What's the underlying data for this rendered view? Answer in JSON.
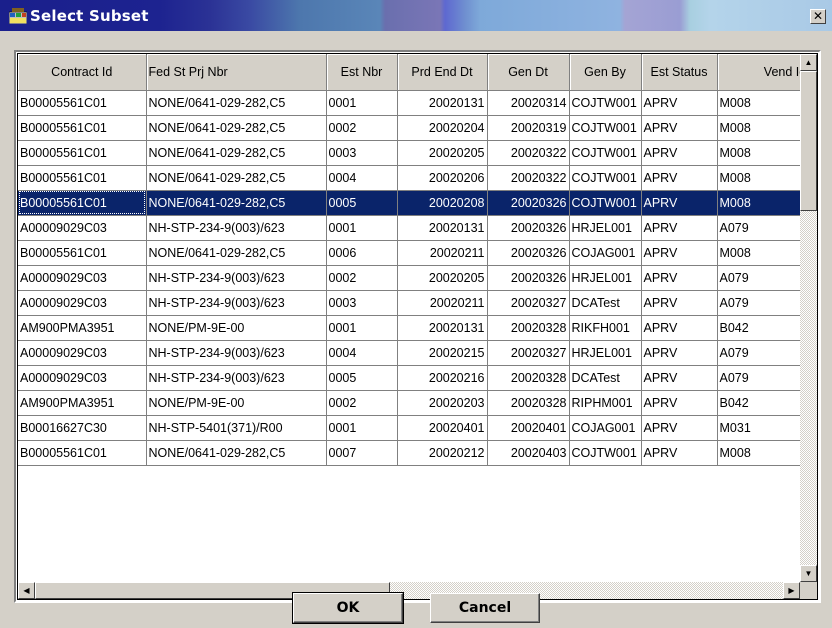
{
  "window": {
    "title": "Select Subset",
    "close_label": "✕"
  },
  "grid": {
    "columns": [
      "Contract Id",
      "Fed St Prj Nbr",
      "Est Nbr",
      "Prd End Dt",
      "Gen Dt",
      "Gen By",
      "Est Status",
      "Vend Id"
    ],
    "column_header_visible": [
      "Contract Id",
      "Fed St Prj Nbr",
      "Est Nbr",
      "Prd End Dt",
      "Gen Dt",
      "Gen By",
      "Est Status",
      "Vend Ic"
    ],
    "selected_row_index": 4,
    "rows": [
      [
        "B00005561C01",
        "NONE/0641-029-282,C5",
        "0001",
        "20020131",
        "20020314",
        "COJTW001",
        "APRV",
        "M008"
      ],
      [
        "B00005561C01",
        "NONE/0641-029-282,C5",
        "0002",
        "20020204",
        "20020319",
        "COJTW001",
        "APRV",
        "M008"
      ],
      [
        "B00005561C01",
        "NONE/0641-029-282,C5",
        "0003",
        "20020205",
        "20020322",
        "COJTW001",
        "APRV",
        "M008"
      ],
      [
        "B00005561C01",
        "NONE/0641-029-282,C5",
        "0004",
        "20020206",
        "20020322",
        "COJTW001",
        "APRV",
        "M008"
      ],
      [
        "B00005561C01",
        "NONE/0641-029-282,C5",
        "0005",
        "20020208",
        "20020326",
        "COJTW001",
        "APRV",
        "M008"
      ],
      [
        "A00009029C03",
        "NH-STP-234-9(003)/623",
        "0001",
        "20020131",
        "20020326",
        "HRJEL001",
        "APRV",
        "A079"
      ],
      [
        "B00005561C01",
        "NONE/0641-029-282,C5",
        "0006",
        "20020211",
        "20020326",
        "COJAG001",
        "APRV",
        "M008"
      ],
      [
        "A00009029C03",
        "NH-STP-234-9(003)/623",
        "0002",
        "20020205",
        "20020326",
        "HRJEL001",
        "APRV",
        "A079"
      ],
      [
        "A00009029C03",
        "NH-STP-234-9(003)/623",
        "0003",
        "20020211",
        "20020327",
        "DCATest",
        "APRV",
        "A079"
      ],
      [
        "AM900PMA3951",
        "NONE/PM-9E-00",
        "0001",
        "20020131",
        "20020328",
        "RIKFH001",
        "APRV",
        "B042"
      ],
      [
        "A00009029C03",
        "NH-STP-234-9(003)/623",
        "0004",
        "20020215",
        "20020327",
        "HRJEL001",
        "APRV",
        "A079"
      ],
      [
        "A00009029C03",
        "NH-STP-234-9(003)/623",
        "0005",
        "20020216",
        "20020328",
        "DCATest",
        "APRV",
        "A079"
      ],
      [
        "AM900PMA3951",
        "NONE/PM-9E-00",
        "0002",
        "20020203",
        "20020328",
        "RIPHM001",
        "APRV",
        "B042"
      ],
      [
        "B00016627C30",
        "NH-STP-5401(371)/R00",
        "0001",
        "20020401",
        "20020401",
        "COJAG001",
        "APRV",
        "M031"
      ],
      [
        "B00005561C01",
        "NONE/0641-029-282,C5",
        "0007",
        "20020212",
        "20020403",
        "COJTW001",
        "APRV",
        "M008"
      ]
    ]
  },
  "buttons": {
    "ok_label": "OK",
    "cancel_label": "Cancel"
  },
  "icons": {
    "app": "dialog-app-icon",
    "close": "close-icon",
    "scroll_up": "scroll-up-arrow-icon",
    "scroll_down": "scroll-down-arrow-icon",
    "scroll_left": "scroll-left-arrow-icon",
    "scroll_right": "scroll-right-arrow-icon"
  },
  "colors": {
    "selection": "#0a246a",
    "face": "#d4d0c8"
  }
}
